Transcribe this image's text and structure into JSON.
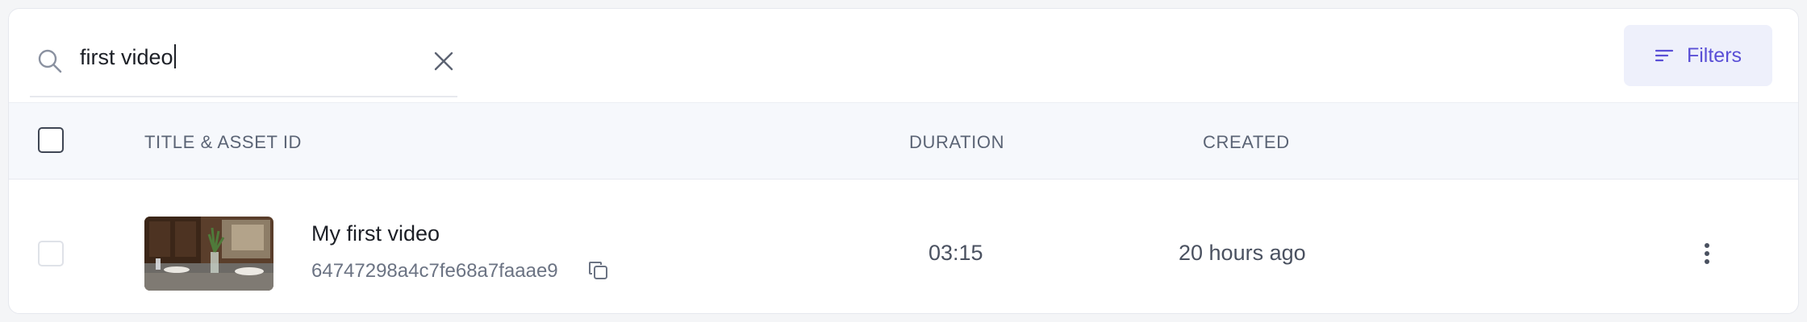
{
  "search": {
    "value": "first video",
    "icon": "search-icon",
    "clear_icon": "close-icon"
  },
  "filters": {
    "label": "Filters",
    "icon": "filter-lines-icon",
    "accent_color": "#5a4fd6",
    "background_color": "#eef0fb"
  },
  "table": {
    "columns": [
      "TITLE & ASSET ID",
      "DURATION",
      "CREATED"
    ],
    "rows": [
      {
        "title": "My first video",
        "asset_id": "64747298a4c7fe68a7faaae9",
        "duration": "03:15",
        "created": "20 hours ago",
        "thumbnail_icon": "video-thumbnail"
      }
    ]
  },
  "colors": {
    "header_background": "#f6f8fc",
    "muted_text": "#6b7383"
  }
}
